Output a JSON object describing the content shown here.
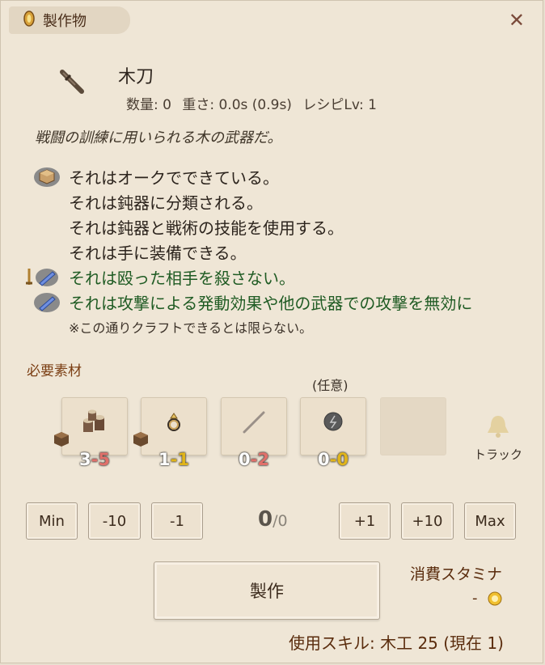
{
  "window": {
    "title": "製作物",
    "close_label": "✕"
  },
  "item": {
    "icon": "wooden-sword-icon",
    "name": "木刀",
    "stats": {
      "quantity": "数量: 0",
      "weight": "重さ: 0.0s (0.9s)",
      "recipe_level": "レシピLv: 1"
    },
    "description": "戦闘の訓練に用いられる木の武器だ。",
    "traits": [
      {
        "text": "それはオークでできている。",
        "icon": "material-cube-icon",
        "color": "normal"
      },
      {
        "text": "それは鈍器に分類される。",
        "icon": "",
        "color": "normal"
      },
      {
        "text": "それは鈍器と戦術の技能を使用する。",
        "icon": "",
        "color": "normal"
      },
      {
        "text": "それは手に装備できる。",
        "icon": "",
        "color": "normal"
      },
      {
        "text": "それは殴った相手を殺さない。",
        "icon": "sword-enchant-icon",
        "color": "green"
      },
      {
        "text": "それは攻撃による発動効果や他の武器での攻撃を無効に",
        "icon": "enchant-icon",
        "color": "green"
      }
    ],
    "note": "※この通りクラフトできるとは限らない。"
  },
  "materials": {
    "label": "必要素材",
    "optional_label": "(任意)",
    "slots": [
      {
        "icon": "log-pile-icon",
        "have": "3",
        "need": "-5",
        "need_color": "red"
      },
      {
        "icon": "ring-icon",
        "have": "1",
        "need": "-1",
        "need_color": "yellow"
      },
      {
        "icon": "stick-icon",
        "have": "0",
        "need": "-2",
        "need_color": "red"
      },
      {
        "icon": "rune-stone-icon",
        "have": "0",
        "need": "-0",
        "need_color": "yellow"
      }
    ],
    "track_label": "トラック"
  },
  "quantity_controls": {
    "min": "Min",
    "minus10": "-10",
    "minus1": "-1",
    "current": "0",
    "max_value": "/0",
    "plus1": "+1",
    "plus10": "+10",
    "max": "Max"
  },
  "craft": {
    "button_label": "製作",
    "stamina_label": "消費スタミナ",
    "stamina_value": "-"
  },
  "skill_text": "使用スキル: 木工 25 (現在 1)",
  "colors": {
    "panel_bg": "#efe6d6",
    "accent_brown": "#5a2c0d",
    "green_text": "#1f5b23",
    "need_red": "#e0706a",
    "need_yellow": "#e0b41a"
  }
}
